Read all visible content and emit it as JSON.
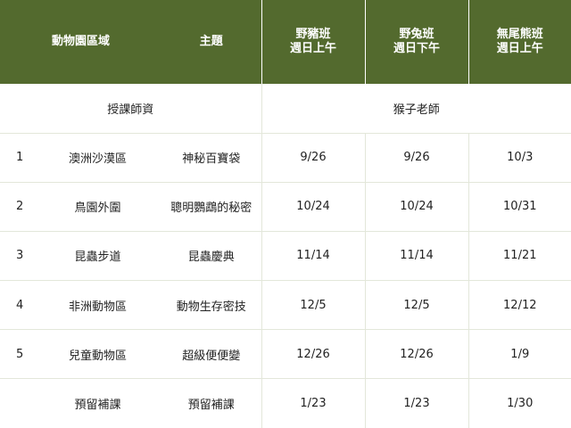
{
  "header": {
    "area": "動物園區域",
    "topic": "主題",
    "classes": [
      {
        "name": "野豬班",
        "time": "週日上午"
      },
      {
        "name": "野兔班",
        "time": "週日下午"
      },
      {
        "name": "無尾熊班",
        "time": "週日上午"
      }
    ]
  },
  "teacher": {
    "label": "授課師資",
    "name": "猴子老師"
  },
  "rows": [
    {
      "num": "1",
      "area": "澳洲沙漠區",
      "topic": "神秘百寶袋",
      "dates": [
        "9/26",
        "9/26",
        "10/3"
      ]
    },
    {
      "num": "2",
      "area": "鳥園外圍",
      "topic": "聰明鸚鵡的秘密",
      "dates": [
        "10/24",
        "10/24",
        "10/31"
      ]
    },
    {
      "num": "3",
      "area": "昆蟲步道",
      "topic": "昆蟲慶典",
      "dates": [
        "11/14",
        "11/14",
        "11/21"
      ]
    },
    {
      "num": "4",
      "area": "非洲動物區",
      "topic": "動物生存密技",
      "dates": [
        "12/5",
        "12/5",
        "12/12"
      ]
    },
    {
      "num": "5",
      "area": "兒童動物區",
      "topic": "超級便便變",
      "dates": [
        "12/26",
        "12/26",
        "1/9"
      ]
    },
    {
      "num": "",
      "area": "預留補課",
      "topic": "預留補課",
      "dates": [
        "1/23",
        "1/23",
        "1/30"
      ]
    }
  ],
  "colors": {
    "header_bg": "#536a2e",
    "header_text": "#ffffff",
    "grid_line": "#e3e7da"
  }
}
